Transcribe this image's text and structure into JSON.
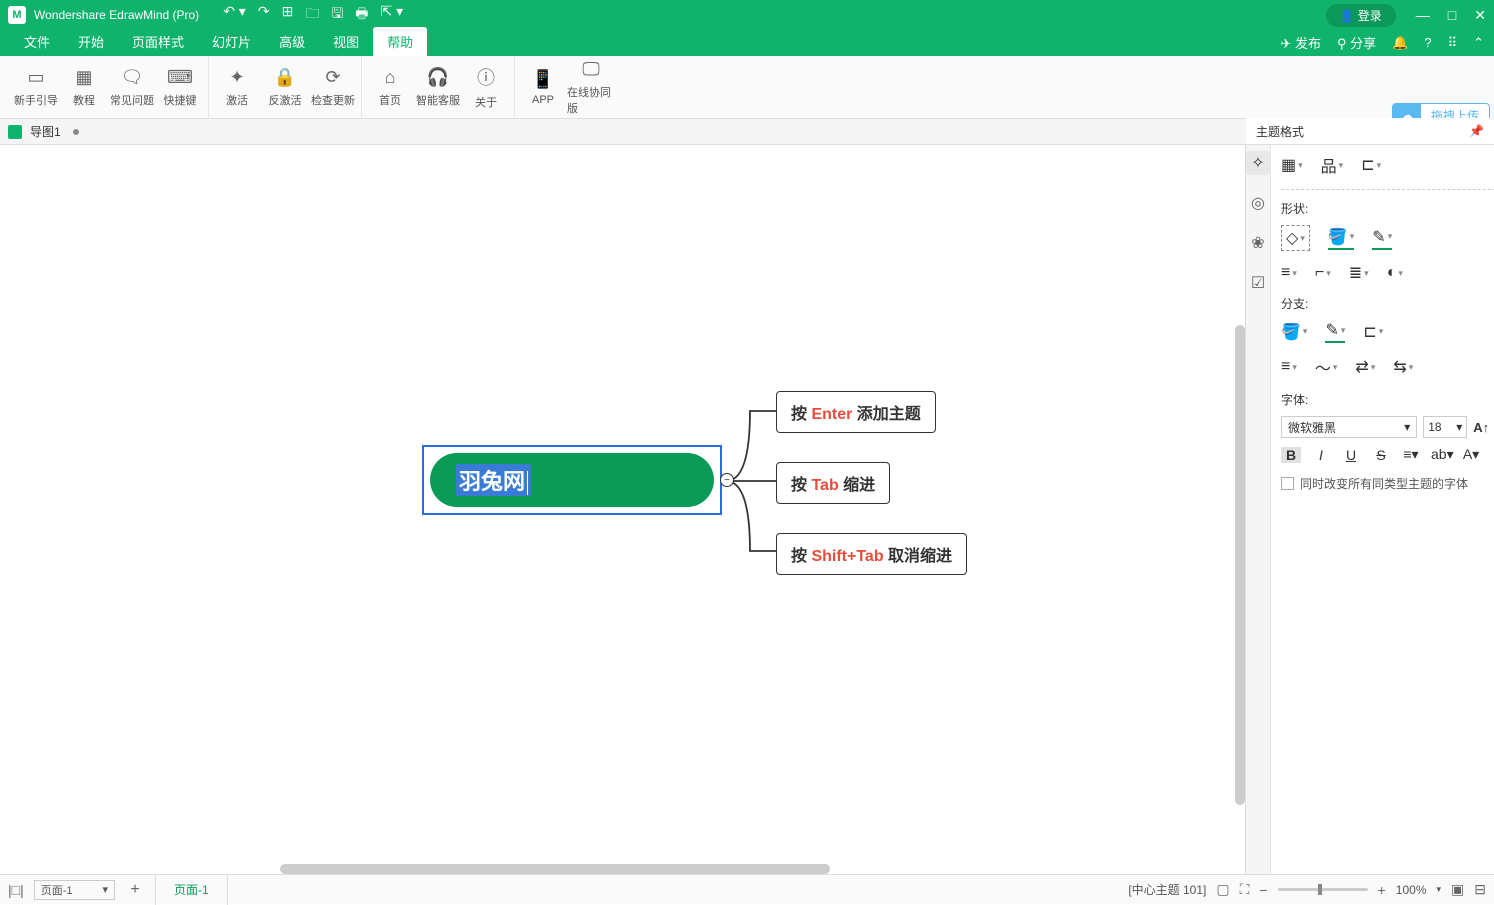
{
  "titlebar": {
    "app_title": "Wondershare EdrawMind (Pro)",
    "login": "登录"
  },
  "menubar": {
    "items": [
      "文件",
      "开始",
      "页面样式",
      "幻灯片",
      "高级",
      "视图",
      "帮助"
    ],
    "active": 6,
    "publish": "发布",
    "share": "分享"
  },
  "ribbon": {
    "g1": [
      {
        "ic": "▭",
        "lb": "新手引导"
      },
      {
        "ic": "▦",
        "lb": "教程"
      },
      {
        "ic": "🗨",
        "lb": "常见问题"
      },
      {
        "ic": "⌨",
        "lb": "快捷键"
      }
    ],
    "g2": [
      {
        "ic": "✦",
        "lb": "激活"
      },
      {
        "ic": "🔒",
        "lb": "反激活"
      },
      {
        "ic": "⟳",
        "lb": "检查更新"
      }
    ],
    "g3": [
      {
        "ic": "⌂",
        "lb": "首页"
      },
      {
        "ic": "🎧",
        "lb": "智能客服"
      },
      {
        "ic": "ⓘ",
        "lb": "关于"
      }
    ],
    "g4": [
      {
        "ic": "📱",
        "lb": "APP"
      },
      {
        "ic": "🖵",
        "lb": "在线协同版"
      }
    ]
  },
  "tabstrip": {
    "name": "导图1"
  },
  "canvas": {
    "root_text": "羽兔网",
    "tip1_pre": "按 ",
    "tip1_key": "Enter",
    "tip1_post": " 添加主题",
    "tip2_pre": "按 ",
    "tip2_key": "Tab",
    "tip2_post": " 缩进",
    "tip3_pre": "按 ",
    "tip3_key": "Shift+Tab",
    "tip3_post": " 取消缩进",
    "collapse": "−"
  },
  "rpanel": {
    "title": "主题格式",
    "upload": "拖拽上传",
    "shape_label": "形状:",
    "branch_label": "分支:",
    "font_label": "字体:",
    "font_name": "微软雅黑",
    "font_size": "18",
    "checkbox": "同时改变所有同类型主题的字体"
  },
  "status": {
    "page_sel": "页面-1",
    "page_tab": "页面-1",
    "info": "[中心主题 101]",
    "zoom": "100%"
  }
}
